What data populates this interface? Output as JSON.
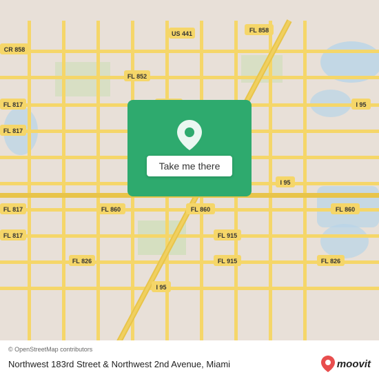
{
  "map": {
    "attribution": "© OpenStreetMap contributors",
    "location_line1": "Northwest 183rd Street & Northwest 2nd Avenue,",
    "location_line2": "Miami",
    "take_me_there_label": "Take me there",
    "moovit_text": "moovit",
    "accent_color": "#2eaa6e",
    "bg_color": "#e8e0d8"
  }
}
